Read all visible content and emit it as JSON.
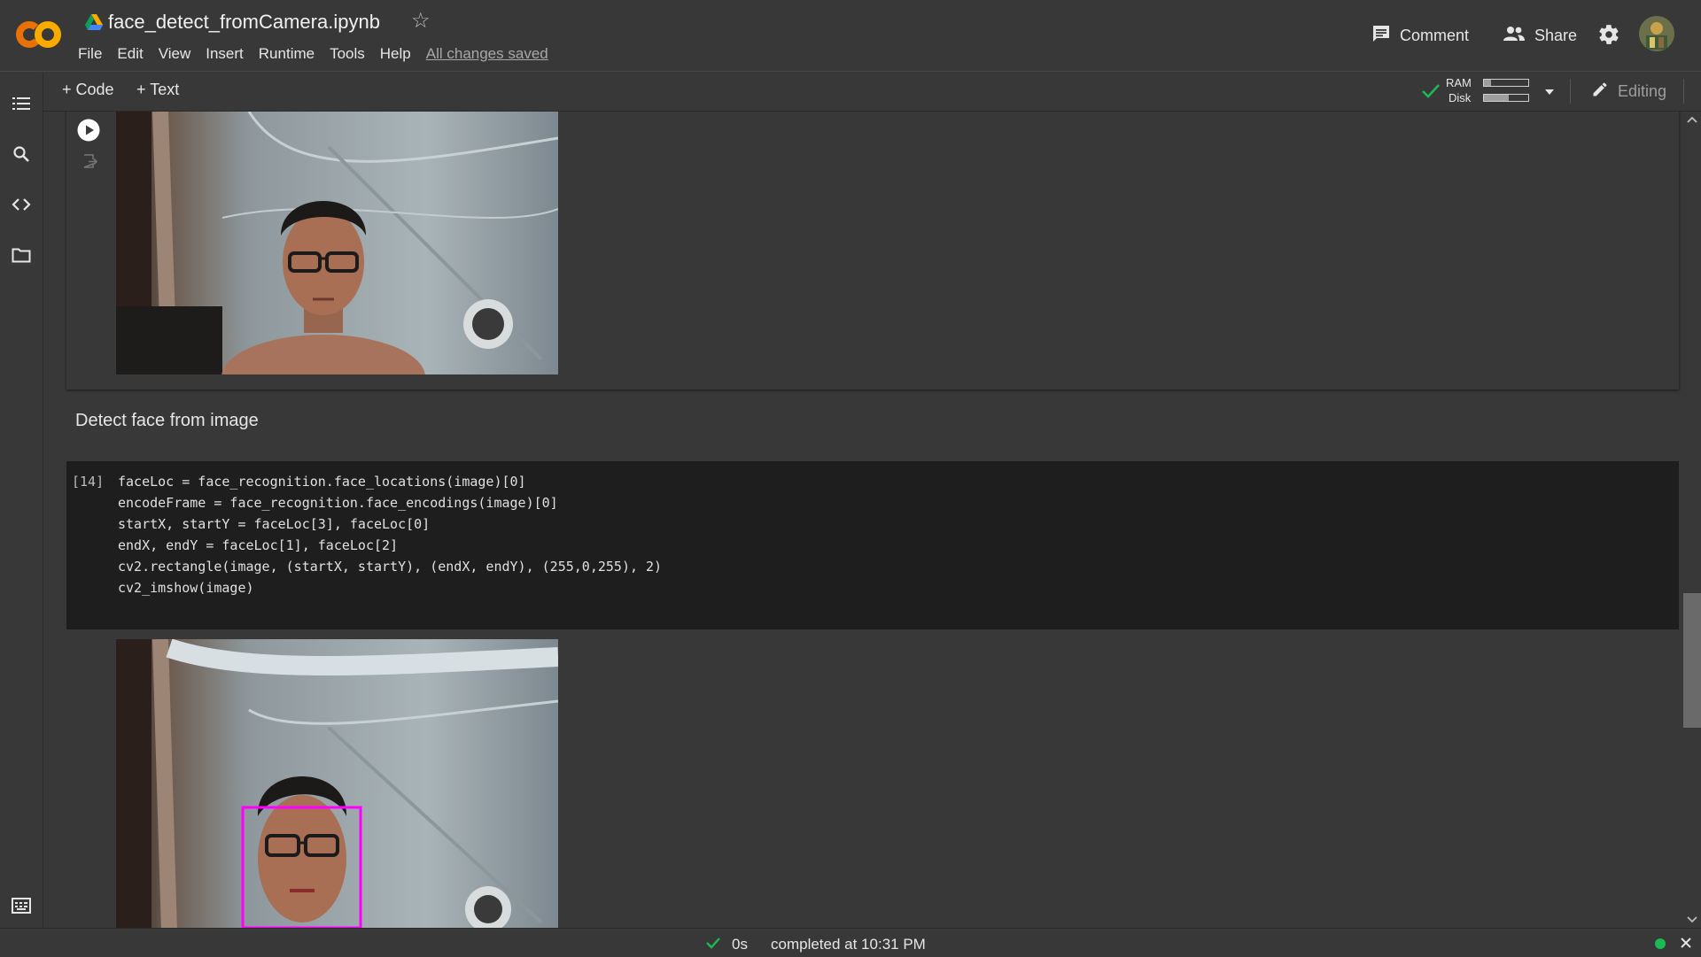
{
  "header": {
    "file_title": "face_detect_fromCamera.ipynb",
    "menu": [
      "File",
      "Edit",
      "View",
      "Insert",
      "Runtime",
      "Tools",
      "Help"
    ],
    "save_status": "All changes saved",
    "comment_label": "Comment",
    "share_label": "Share",
    "icons": {
      "logo": "colab-logo-icon",
      "drive": "google-drive-icon",
      "star": "star-outline-icon",
      "comment": "comment-icon",
      "share": "people-icon",
      "settings": "gear-icon",
      "avatar": "user-avatar"
    },
    "colors": {
      "logo_orange": "#f9ab00",
      "logo_orange_dark": "#e8710a"
    }
  },
  "toolbar": {
    "add_code_label": "+ Code",
    "add_text_label": "+ Text",
    "ram_label": "RAM",
    "disk_label": "Disk",
    "ram_usage": 0.15,
    "disk_usage": 0.55,
    "editing_label": "Editing",
    "icons": {
      "connected": "check-icon",
      "dropdown": "triangle-down-icon",
      "edit": "pencil-icon",
      "collapse": "chevron-up-icon"
    },
    "colors": {
      "connected_green": "#1db954"
    }
  },
  "sidebar": {
    "items": [
      "table-of-contents-icon",
      "search-icon",
      "code-snippets-icon",
      "files-icon"
    ],
    "bottom": "terminal-icon"
  },
  "notebook": {
    "text_cell": "Detect face from image",
    "code_cell": {
      "execution_count": "[14]",
      "lines": [
        "faceLoc = face_recognition.face_locations(image)[0]",
        "encodeFrame = face_recognition.face_encodings(image)[0]",
        "startX, startY = faceLoc[3], faceLoc[0]",
        "endX, endY = faceLoc[1], faceLoc[2]",
        "cv2.rectangle(image, (startX, startY), (endX, endY), (255,0,255), 2)",
        "cv2_imshow(image)"
      ]
    },
    "face_box_color": "#ff00ff"
  },
  "statusbar": {
    "duration": "0s",
    "status_text": "completed at 10:31 PM",
    "icons": {
      "done": "check-icon",
      "session": "green-dot-icon",
      "close": "close-icon"
    }
  }
}
